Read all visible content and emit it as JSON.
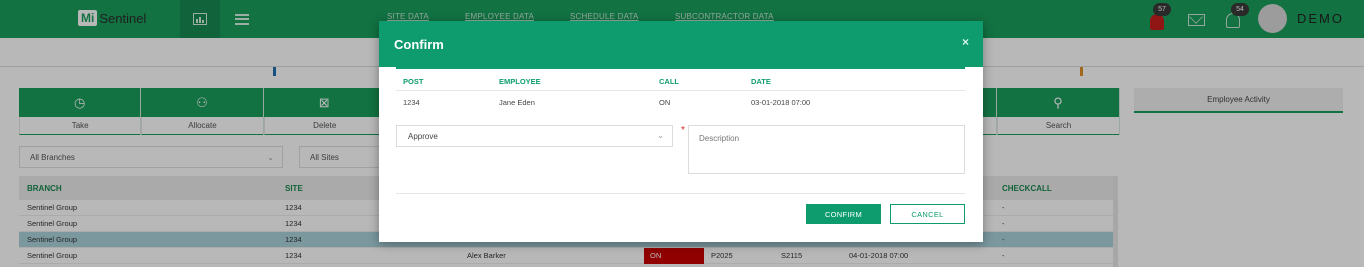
{
  "header": {
    "logo_mi": "Mi",
    "logo_text": "Sentinel",
    "nav": [
      "SITE DATA",
      "EMPLOYEE DATA",
      "SCHEDULE DATA",
      "SUBCONTRACTOR DATA"
    ],
    "alarm_count": "57",
    "notification_count": "54",
    "user_name": "DEMO"
  },
  "actions": [
    "Take",
    "Allocate",
    "Delete",
    "",
    "",
    "",
    "",
    "",
    "Search"
  ],
  "side_panel": {
    "tab": "Employee Activity"
  },
  "filters": {
    "branch": "All Branches",
    "site": "All Sites"
  },
  "table": {
    "headers": {
      "branch": "BRANCH",
      "site": "SITE",
      "checkcall": "CHECKCALL"
    },
    "rows": [
      {
        "branch": "Sentinel Group",
        "site": "1234",
        "checkcall": "-"
      },
      {
        "branch": "Sentinel Group",
        "site": "1234",
        "checkcall": "-"
      },
      {
        "branch": "Sentinel Group",
        "site": "1234",
        "checkcall": "-"
      },
      {
        "branch": "Sentinel Group",
        "site": "1234",
        "employee": "Alex Barker",
        "call": "ON",
        "post": "P2025",
        "site2": "S2115",
        "date": "04-01-2018 07:00",
        "checkcall": "-"
      }
    ]
  },
  "modal": {
    "title": "Confirm",
    "close": "×",
    "columns": {
      "post": "POST",
      "employee": "EMPLOYEE",
      "call": "CALL",
      "date": "DATE"
    },
    "row": {
      "post": "1234",
      "employee": "Jane Eden",
      "call": "ON",
      "date": "03-01-2018 07:00"
    },
    "select_value": "Approve",
    "required_mark": "*",
    "description_placeholder": "Description",
    "confirm_label": "CONFIRM",
    "cancel_label": "CANCEL"
  },
  "colors": {
    "brand": "#1a9e5c",
    "modal_accent": "#0e9c6e",
    "alarm": "#c81e1e",
    "on_cell": "#c80000",
    "selected_row": "#a9d3dc"
  },
  "icons": [
    "chart-icon",
    "menu-icon",
    "alarm-icon",
    "mail-icon",
    "bell-icon",
    "avatar",
    "take-icon",
    "allocate-icon",
    "delete-icon",
    "search-icon",
    "chevron-down-icon",
    "close-icon"
  ]
}
